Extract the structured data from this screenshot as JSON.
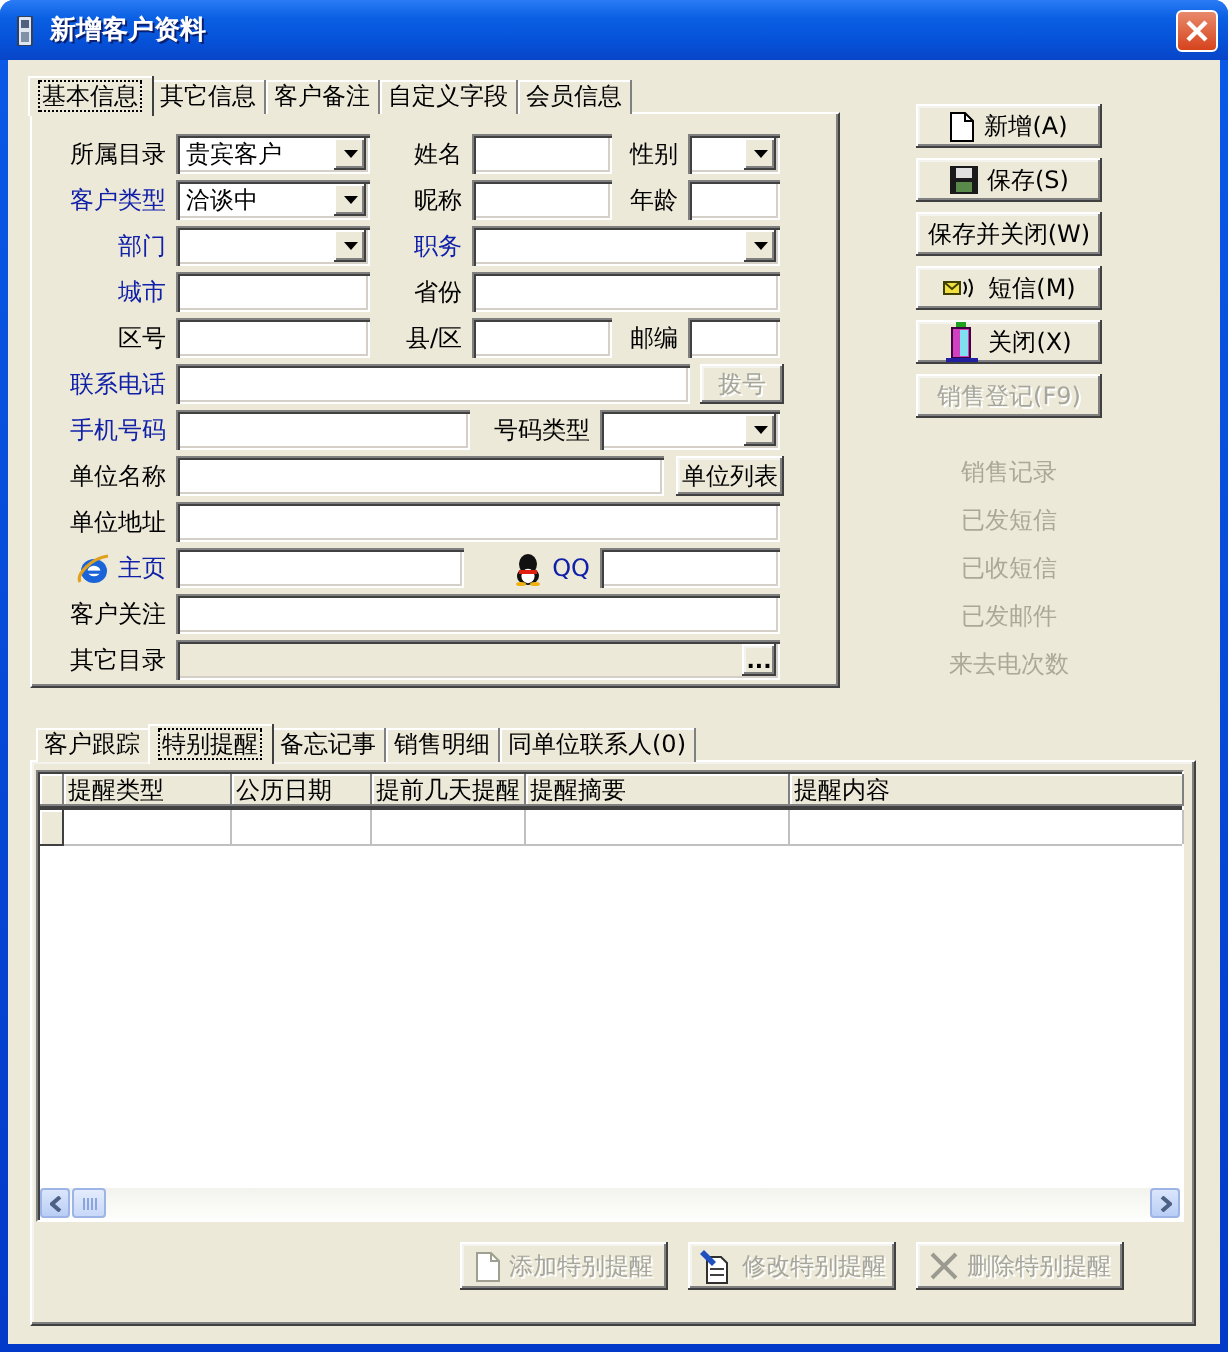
{
  "window": {
    "title": "新增客户资料"
  },
  "info_tabs": [
    {
      "label": "基本信息",
      "selected": true
    },
    {
      "label": "其它信息",
      "selected": false
    },
    {
      "label": "客户备注",
      "selected": false
    },
    {
      "label": "自定义字段",
      "selected": false
    },
    {
      "label": "会员信息",
      "selected": false
    }
  ],
  "form": {
    "rows": [
      {
        "items": [
          {
            "kind": "label",
            "text": "所属目录",
            "link": false
          },
          {
            "kind": "combo",
            "value": "贵宾客户"
          },
          {
            "kind": "label",
            "text": "姓名",
            "link": false
          },
          {
            "kind": "field"
          },
          {
            "kind": "label",
            "text": "性别",
            "link": false
          },
          {
            "kind": "combo"
          }
        ]
      },
      {
        "items": [
          {
            "kind": "label",
            "text": "客户类型",
            "link": true
          },
          {
            "kind": "combo",
            "value": "洽谈中"
          },
          {
            "kind": "label",
            "text": "昵称",
            "link": false
          },
          {
            "kind": "field"
          },
          {
            "kind": "label",
            "text": "年龄",
            "link": false
          },
          {
            "kind": "field"
          }
        ]
      },
      {
        "items": [
          {
            "kind": "label",
            "text": "部门",
            "link": true
          },
          {
            "kind": "combo"
          },
          {
            "kind": "label",
            "text": "职务",
            "link": true
          },
          {
            "kind": "combo"
          }
        ]
      },
      {
        "items": [
          {
            "kind": "label",
            "text": "城市",
            "link": true
          },
          {
            "kind": "field"
          },
          {
            "kind": "label",
            "text": "省份",
            "link": false
          },
          {
            "kind": "field"
          }
        ]
      },
      {
        "items": [
          {
            "kind": "label",
            "text": "区号",
            "link": false
          },
          {
            "kind": "field"
          },
          {
            "kind": "label",
            "text": "县/区",
            "link": false
          },
          {
            "kind": "field"
          },
          {
            "kind": "label",
            "text": "邮编",
            "link": false
          },
          {
            "kind": "field"
          }
        ]
      },
      {
        "items": [
          {
            "kind": "label",
            "text": "联系电话",
            "link": true
          },
          {
            "kind": "field"
          },
          {
            "kind": "button",
            "label": "拨号",
            "disabled": true
          }
        ]
      },
      {
        "items": [
          {
            "kind": "label",
            "text": "手机号码",
            "link": true
          },
          {
            "kind": "field"
          },
          {
            "kind": "label",
            "text": "号码类型",
            "link": false
          },
          {
            "kind": "combo"
          }
        ]
      },
      {
        "items": [
          {
            "kind": "label",
            "text": "单位名称",
            "link": false
          },
          {
            "kind": "field"
          },
          {
            "kind": "button",
            "label": "单位列表",
            "disabled": false
          }
        ]
      },
      {
        "items": [
          {
            "kind": "label",
            "text": "单位地址",
            "link": false
          },
          {
            "kind": "field"
          }
        ]
      },
      {
        "items": [
          {
            "kind": "label",
            "text": "主页",
            "link": true
          },
          {
            "kind": "field"
          },
          {
            "kind": "label",
            "text": "QQ",
            "link": true
          },
          {
            "kind": "field"
          }
        ]
      },
      {
        "items": [
          {
            "kind": "label",
            "text": "客户关注",
            "link": false
          },
          {
            "kind": "field"
          }
        ]
      },
      {
        "items": [
          {
            "kind": "label",
            "text": "其它目录",
            "link": false
          },
          {
            "kind": "browse",
            "button_label": "...",
            "disabled": true
          }
        ]
      }
    ]
  },
  "actions": [
    {
      "label": "新增(A)",
      "disabled": false
    },
    {
      "label": "保存(S)",
      "disabled": false
    },
    {
      "label": "保存并关闭(W)",
      "disabled": false
    },
    {
      "label": "短信(M)",
      "disabled": false
    },
    {
      "label": "关闭(X)",
      "disabled": false
    },
    {
      "label": "销售登记(F9)",
      "disabled": true
    }
  ],
  "records": [
    {
      "label": "销售记录",
      "disabled": true
    },
    {
      "label": "已发短信",
      "disabled": true
    },
    {
      "label": "已收短信",
      "disabled": true
    },
    {
      "label": "已发邮件",
      "disabled": true
    },
    {
      "label": "来去电次数",
      "disabled": true
    }
  ],
  "detail_tabs": [
    {
      "label": "客户跟踪",
      "selected": false
    },
    {
      "label": "特别提醒",
      "selected": true
    },
    {
      "label": "备忘记事",
      "selected": false
    },
    {
      "label": "销售明细",
      "selected": false
    },
    {
      "label": "同单位联系人(0)",
      "selected": false
    }
  ],
  "reminder_table": {
    "columns": [
      "提醒类型",
      "公历日期",
      "提前几天提醒",
      "提醒摘要",
      "提醒内容"
    ]
  },
  "reminder_buttons": [
    {
      "label": "添加特别提醒",
      "disabled": true
    },
    {
      "label": "修改特别提醒",
      "disabled": true
    },
    {
      "label": "删除特别提醒",
      "disabled": true
    }
  ]
}
